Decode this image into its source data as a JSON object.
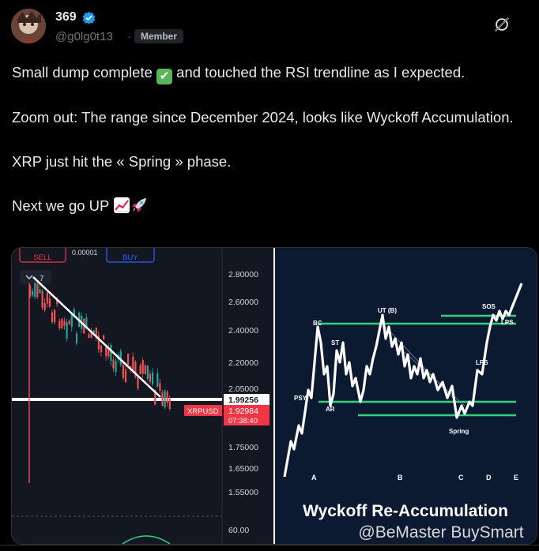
{
  "user": {
    "name": "369",
    "handle": "@g0lg0t13",
    "badge": "Member"
  },
  "post": {
    "line1": "Small dump complete",
    "line1_end": "and touched the RSI trendline as I expected.",
    "line2": "Zoom out: The range since December 2024, looks like Wyckoff Accumulation.",
    "line3": "XRP just hit the « Spring » phase.",
    "line4": "Next we go UP"
  },
  "chart_left": {
    "sell_label": "SELL",
    "buy_label": "BUY",
    "spread": "0.00001",
    "indicator": "7",
    "price_levels": [
      "2.80000",
      "2.60000",
      "2.40000",
      "2.20000",
      "2.05000",
      "1.75000",
      "1.65000",
      "1.55000"
    ],
    "current_price": "1.99256",
    "ticker": "XRPUSD",
    "last_price": "1.92984",
    "countdown": "07:38:40",
    "rsi_level": "60.00"
  },
  "chart_right": {
    "title": "Wyckoff Re-Accumulation",
    "watermark": "@BeMaster BuySmart",
    "labels": [
      "PSY",
      "BC",
      "AR",
      "ST",
      "UT (B)",
      "Spring",
      "LPS",
      "SOS",
      "LPS"
    ],
    "phases": [
      "A",
      "B",
      "C",
      "D",
      "E"
    ]
  },
  "colors": {
    "accent_green": "#36d17a",
    "price_red": "#f23645",
    "verified_blue": "#1d9bf0"
  }
}
